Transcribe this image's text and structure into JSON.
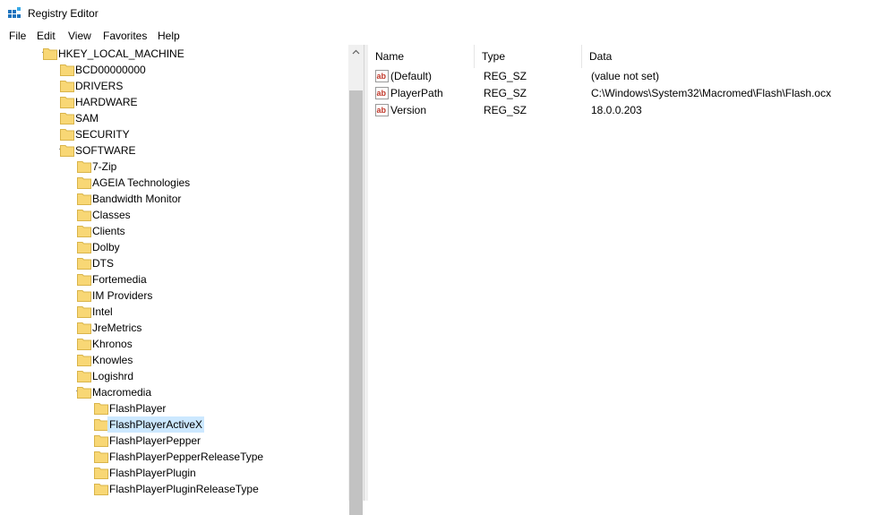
{
  "window": {
    "title": "Registry Editor"
  },
  "menu": [
    {
      "label": "File"
    },
    {
      "label": "Edit"
    },
    {
      "label": "View"
    },
    {
      "label": "Favorites"
    },
    {
      "label": "Help"
    }
  ],
  "tree": [
    {
      "label": "HKEY_LOCAL_MACHINE",
      "expander": "expanded"
    },
    {
      "label": "BCD00000000",
      "expander": "collapsed"
    },
    {
      "label": "DRIVERS",
      "expander": "collapsed"
    },
    {
      "label": "HARDWARE",
      "expander": "collapsed"
    },
    {
      "label": "SAM",
      "expander": "collapsed"
    },
    {
      "label": "SECURITY",
      "expander": "none"
    },
    {
      "label": "SOFTWARE",
      "expander": "expanded"
    },
    {
      "label": "7-Zip",
      "expander": "none"
    },
    {
      "label": "AGEIA Technologies",
      "expander": "collapsed"
    },
    {
      "label": "Bandwidth Monitor",
      "expander": "none"
    },
    {
      "label": "Classes",
      "expander": "collapsed"
    },
    {
      "label": "Clients",
      "expander": "collapsed"
    },
    {
      "label": "Dolby",
      "expander": "collapsed"
    },
    {
      "label": "DTS",
      "expander": "none"
    },
    {
      "label": "Fortemedia",
      "expander": "collapsed"
    },
    {
      "label": "IM Providers",
      "expander": "collapsed"
    },
    {
      "label": "Intel",
      "expander": "collapsed"
    },
    {
      "label": "JreMetrics",
      "expander": "none"
    },
    {
      "label": "Khronos",
      "expander": "collapsed"
    },
    {
      "label": "Knowles",
      "expander": "collapsed"
    },
    {
      "label": "Logishrd",
      "expander": "collapsed"
    },
    {
      "label": "Macromedia",
      "expander": "expanded"
    },
    {
      "label": "FlashPlayer",
      "expander": "collapsed"
    },
    {
      "label": "FlashPlayerActiveX",
      "expander": "none",
      "selected": true
    },
    {
      "label": "FlashPlayerPepper",
      "expander": "none"
    },
    {
      "label": "FlashPlayerPepperReleaseType",
      "expander": "none"
    },
    {
      "label": "FlashPlayerPlugin",
      "expander": "none"
    },
    {
      "label": "FlashPlayerPluginReleaseType",
      "expander": "none"
    }
  ],
  "values": {
    "columns": [
      "Name",
      "Type",
      "Data"
    ],
    "rows": [
      {
        "name": "(Default)",
        "type": "REG_SZ",
        "data": "(value not set)",
        "icon": "string-value-icon"
      },
      {
        "name": "PlayerPath",
        "type": "REG_SZ",
        "data": "C:\\Windows\\System32\\Macromed\\Flash\\Flash.ocx",
        "icon": "string-value-icon"
      },
      {
        "name": "Version",
        "type": "REG_SZ",
        "data": "18.0.0.203",
        "icon": "string-value-icon"
      }
    ]
  },
  "colors": {
    "selection": "#cce8ff",
    "folder": "#f8d775",
    "scrollbar_thumb": "#c2c2c2"
  }
}
